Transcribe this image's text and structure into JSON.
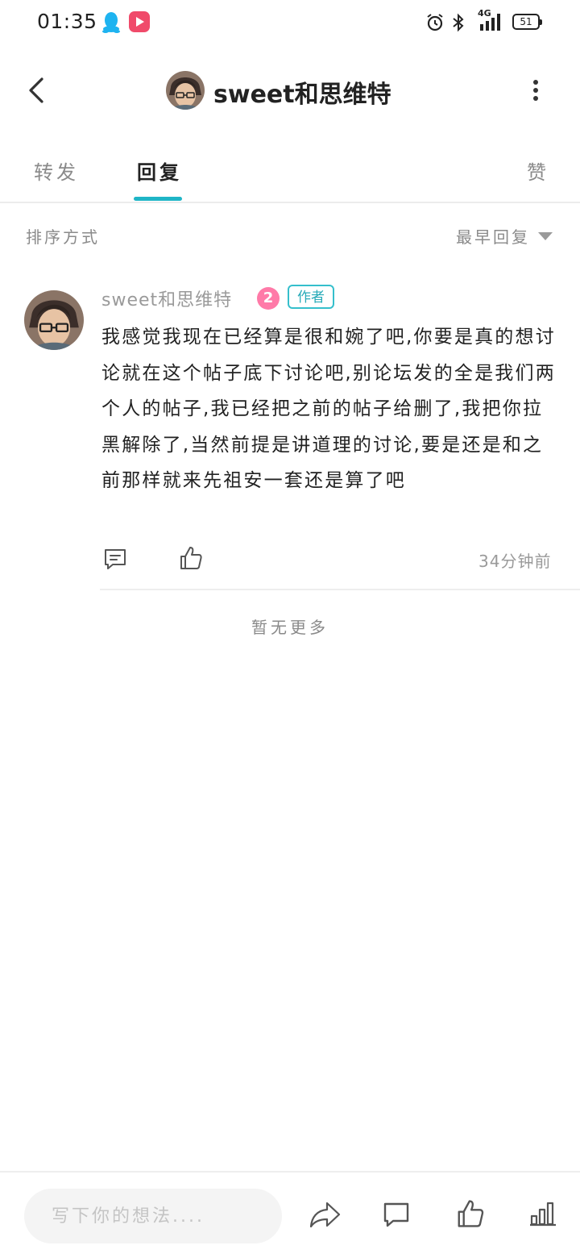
{
  "status_bar": {
    "time": "01:35",
    "network": "4G",
    "battery": "51"
  },
  "header": {
    "title": "sweet和思维特"
  },
  "tabs": [
    {
      "label": "转发",
      "active": false
    },
    {
      "label": "回复",
      "active": true
    },
    {
      "label": "赞",
      "active": false
    }
  ],
  "sort": {
    "label": "排序方式",
    "value": "最早回复"
  },
  "comment": {
    "username": "sweet和思维特",
    "level": "2",
    "author_badge": "作者",
    "text": "我感觉我现在已经算是很和婉了吧,你要是真的想讨论就在这个帖子底下讨论吧,别论坛发的全是我们两个人的帖子,我已经把之前的帖子给删了,我把你拉黑解除了,当然前提是讲道理的讨论,要是还是和之前那样就来先祖安一套还是算了吧",
    "time": "34分钟前"
  },
  "footer_note": "暂无更多",
  "bottom_bar": {
    "input_placeholder": "写下你的想法...."
  },
  "colors": {
    "accent": "#1fb5c6",
    "level_badge": "#ff7aa8",
    "secondary_text": "#8a8a8a"
  },
  "icons": [
    "qq-icon",
    "video-app-icon",
    "alarm-icon",
    "bluetooth-icon",
    "signal-icon",
    "back-icon",
    "more-icon",
    "sort-arrow-icon",
    "reply-icon",
    "like-icon",
    "share-icon",
    "chat-icon",
    "stats-icon"
  ]
}
